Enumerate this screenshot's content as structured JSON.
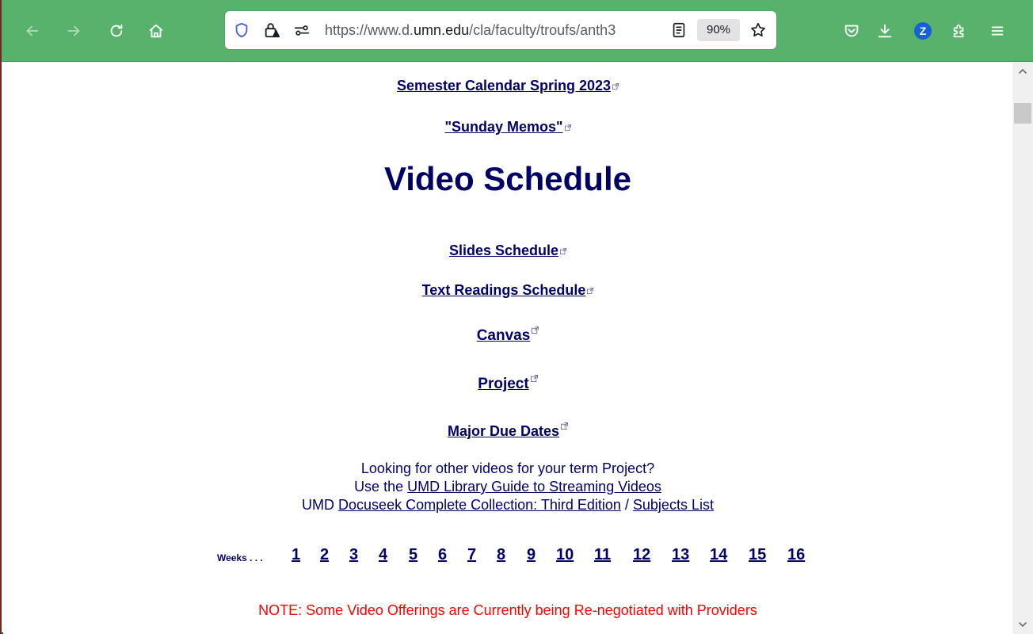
{
  "browser": {
    "url_host_prefix": "https://www.d.",
    "url_host_main": "umn.edu",
    "url_path": "/cla/faculty/troufs/anth3",
    "url_full": "https://www.d.umn.edu/cla/faculty/troufs/anth3",
    "zoom": "90%",
    "extension_badge": "Z",
    "accent_color": "#58b26c"
  },
  "page": {
    "links_top": [
      {
        "label": "Semester Calendar Spring 2023"
      },
      {
        "label": "\"Sunday Memos\""
      }
    ],
    "title": "Video Schedule",
    "links_mid": [
      {
        "label": "Slides Schedule"
      },
      {
        "label": "Text Readings Schedule"
      },
      {
        "label": "Canvas"
      },
      {
        "label": "Project"
      },
      {
        "label": "Major Due Dates"
      }
    ],
    "info": {
      "line1": "Looking for other videos for your term Project?",
      "line2_prefix": "Use the ",
      "line2_link": "UMD Library Guide to Streaming Videos",
      "line3_prefix": "UMD ",
      "line3_link1": "Docuseek Complete Collection: Third Edition",
      "line3_sep": " / ",
      "line3_link2": "Subjects List"
    },
    "weeks_label": "Weeks . . .",
    "weeks": [
      "1",
      "2",
      "3",
      "4",
      "5",
      "6",
      "7",
      "8",
      "9",
      "10",
      "11",
      "12",
      "13",
      "14",
      "15",
      "16"
    ],
    "note": "NOTE: Some Video Offerings are Currently being Re-negotiated with Providers",
    "link_color": "#000066",
    "note_color": "#ff0000"
  }
}
